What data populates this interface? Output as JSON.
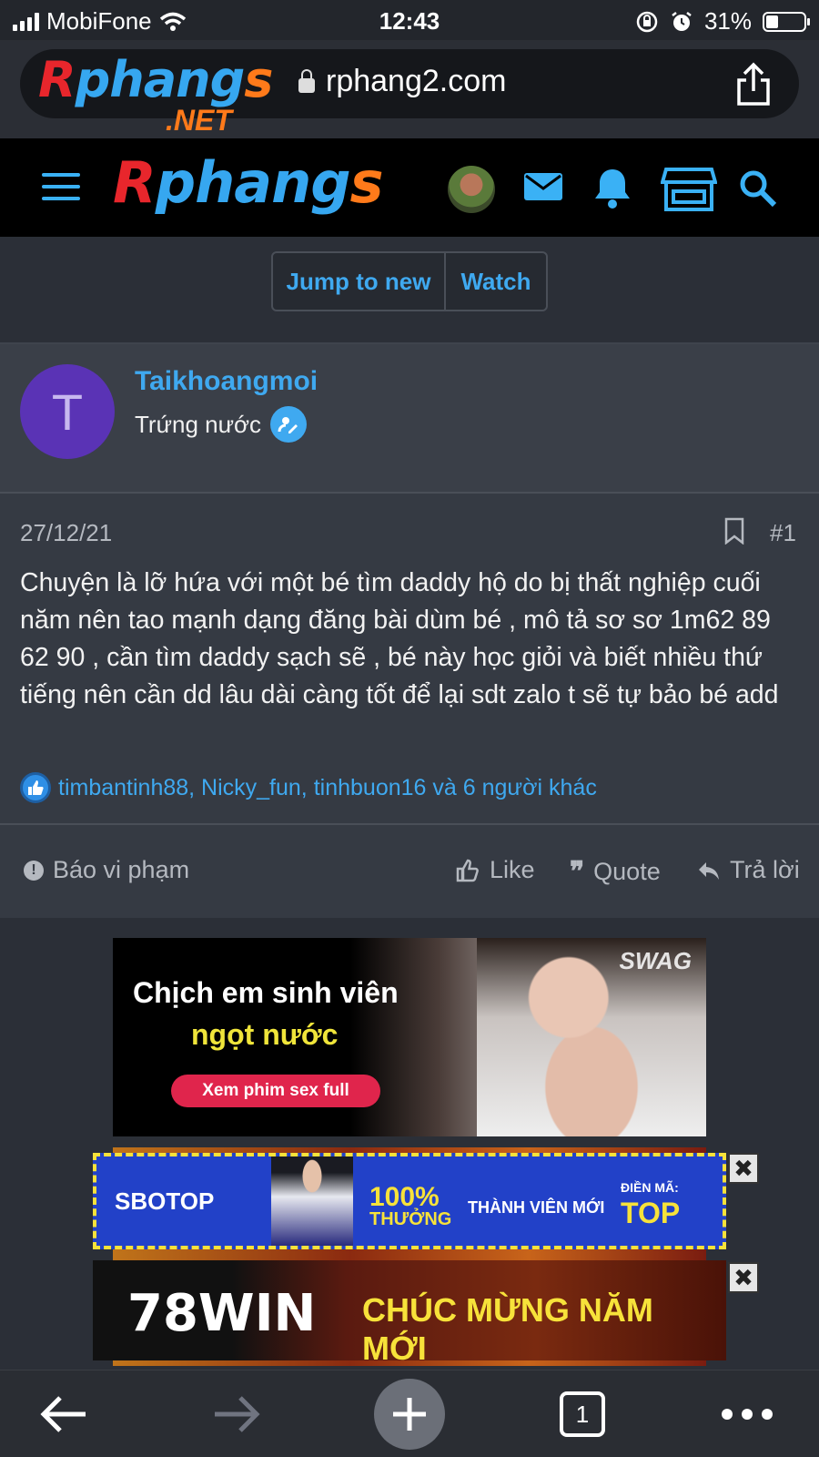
{
  "status_bar": {
    "carrier": "MobiFone",
    "time": "12:43",
    "battery": "31%"
  },
  "browser": {
    "logo_text": "Rphangs",
    "logo_net": ".NET",
    "url": "rphang2.com"
  },
  "site_header": {
    "brand": "Rphangs"
  },
  "thread_actions": {
    "jump_label": "Jump to new",
    "watch_label": "Watch"
  },
  "post": {
    "author_initial": "T",
    "author": "Taikhoangmoi",
    "user_title": "Trứng nước",
    "date": "27/12/21",
    "number": "#1",
    "body": "Chuyện là lỡ hứa với một bé tìm daddy hộ do bị thất nghiệp cuối năm nên tao mạnh dạng đăng bài dùm bé , mô tả sơ sơ 1m62 89 62 90 , cần tìm daddy sạch sẽ , bé này học giỏi và biết nhiều thứ tiếng nên cần dd lâu dài càng tốt để lại sdt zalo t sẽ tự bảo bé add",
    "reactions": "timbantinh88, Nicky_fun, tinhbuon16 và 6 người khác",
    "report_label": "Báo vi phạm",
    "like_label": "Like",
    "quote_label": "Quote",
    "reply_label": "Trả lời"
  },
  "ads": {
    "main_line1": "Chịch em sinh viên",
    "main_line2": "ngọt nước",
    "main_cta": "Xem phim sex full",
    "main_brand": "SWAG",
    "sbo_brand": "SBOTOP",
    "sbo_pct": "100%",
    "sbo_bonus": "THƯỞNG",
    "sbo_new": "THÀNH VIÊN MỚI",
    "sbo_code_label": "ĐIỀN MÃ:",
    "sbo_code": "TOP",
    "win_brand": "78WIN",
    "win_msg": "CHÚC MỪNG NĂM MỚI",
    "close": "✖"
  },
  "toolbar": {
    "tab_count": "1"
  },
  "colors": {
    "accent": "#3fa9f0",
    "bg": "#2b2f37",
    "card": "#353a43",
    "header": "#000000"
  }
}
